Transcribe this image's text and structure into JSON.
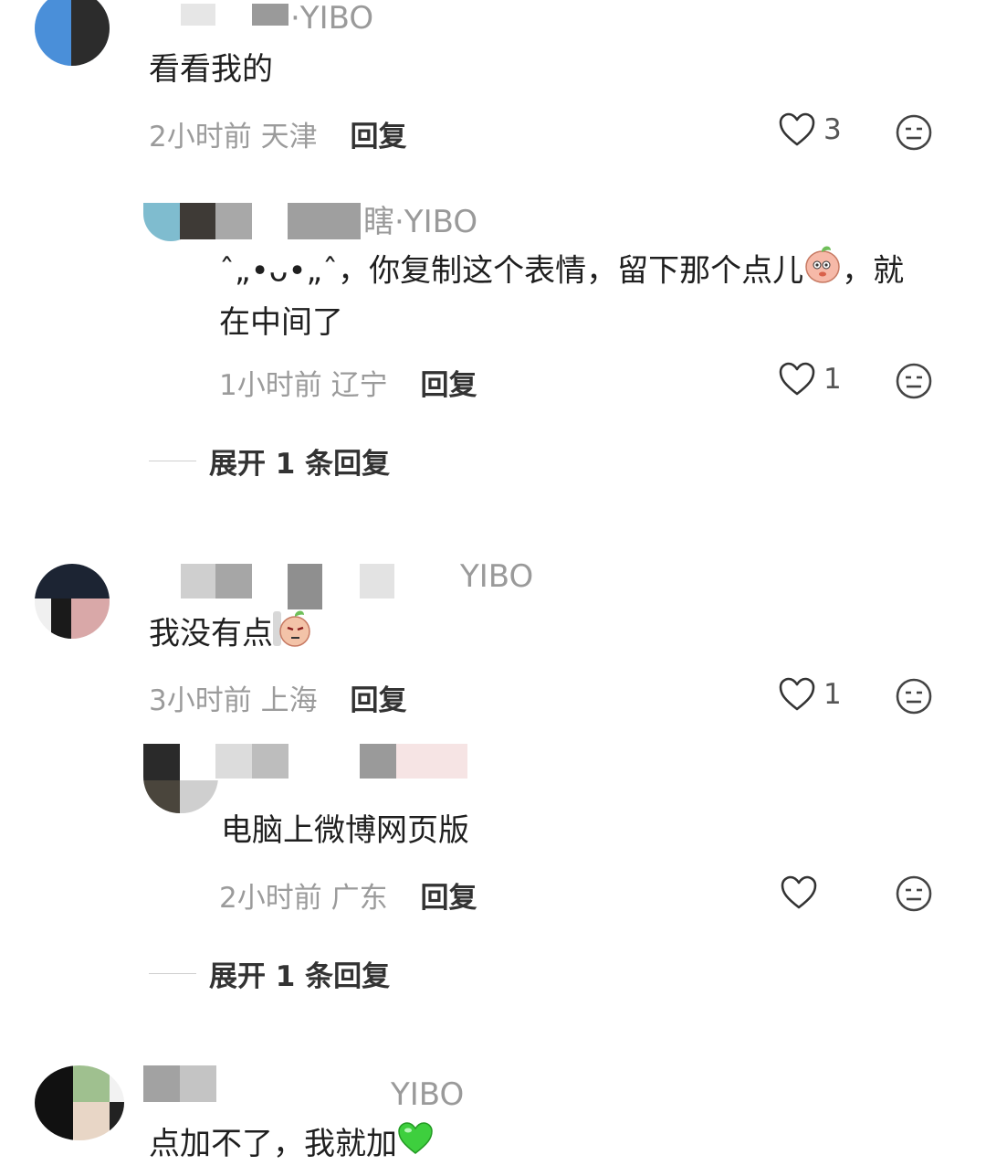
{
  "comments": [
    {
      "name_suffix": "·YIBO",
      "text": "看看我的",
      "time": "2小时前",
      "location": "天津",
      "reply_label": "回复",
      "likes": "3",
      "replies": [
        {
          "name_suffix": "瞎·YIBO",
          "text_line1": "ˆ„•ᴗ•„ˆ，你复制这个表情，留下那个点儿",
          "text_line1_tail": "，就",
          "text_line2": "在中间了",
          "time": "1小时前",
          "location": "辽宁",
          "reply_label": "回复",
          "likes": "1"
        }
      ],
      "expand_label": "展开 1 条回复"
    },
    {
      "name_suffix": "YIBO",
      "text": "我没有点",
      "time": "3小时前",
      "location": "上海",
      "reply_label": "回复",
      "likes": "1",
      "replies": [
        {
          "text": "电脑上微博网页版",
          "time": "2小时前",
          "location": "广东",
          "reply_label": "回复"
        }
      ],
      "expand_label": "展开 1 条回复"
    },
    {
      "name_suffix": "YIBO",
      "text": "点加不了，我就加"
    }
  ],
  "colors": {
    "meta_gray": "#9b9b9b",
    "text_dark": "#1f1f1f",
    "heart_green": "#3ecf3e"
  }
}
